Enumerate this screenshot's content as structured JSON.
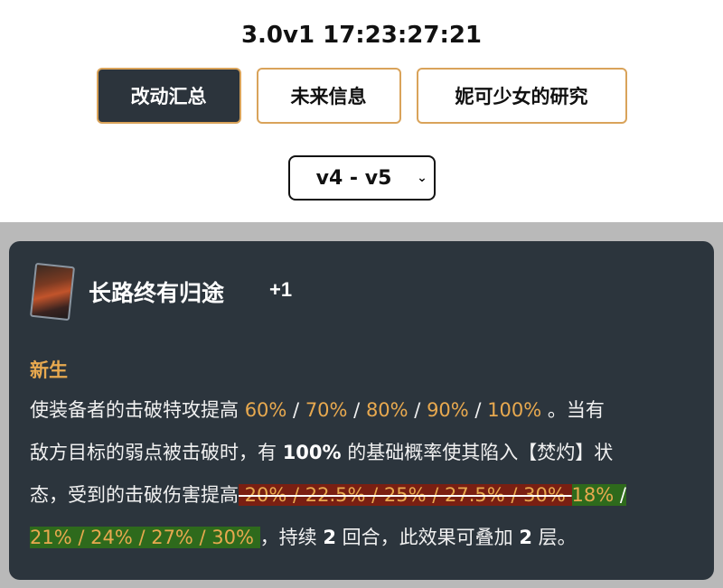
{
  "header": {
    "version": "3.0v1 17:23:27:21",
    "tabs": [
      "改动汇总",
      "未来信息",
      "妮可少女的研究"
    ],
    "select_value": "v4 - v5"
  },
  "card": {
    "icon": "lightcone-thumbnail",
    "title": "长路终有归途",
    "plus": "+1",
    "subhead": "新生",
    "line1": {
      "a": "使装备者的击破特攻提高 ",
      "v1": "60%",
      "s1": " / ",
      "v2": "70%",
      "s2": " / ",
      "v3": "80%",
      "s3": " / ",
      "v4": "90%",
      "s4": " / ",
      "v5": "100%",
      "b": " 。当有"
    },
    "line2": {
      "a": "敌方目标的弱点被击破时，有 ",
      "bold": "100%",
      "b": " 的基础概率使其陷入【焚灼】状"
    },
    "line3": {
      "a": "态，受到的击破伤害提高",
      "old": " 20% / 22.5% / 25% / 27.5% / 30% ",
      "new_a": "18%",
      "new_s": " /"
    },
    "line4": {
      "new": "21% / 24% / 27% / 30% ",
      "a": "，持续 ",
      "b1": "2",
      "b": " 回合，此效果可叠加 ",
      "b2": "2",
      "c": " 层。"
    },
    "colors": {
      "old_bg": "#7a1f12",
      "new_bg": "#2e6a1c",
      "accent": "#e8a94f",
      "card_bg": "#2c353d"
    }
  }
}
